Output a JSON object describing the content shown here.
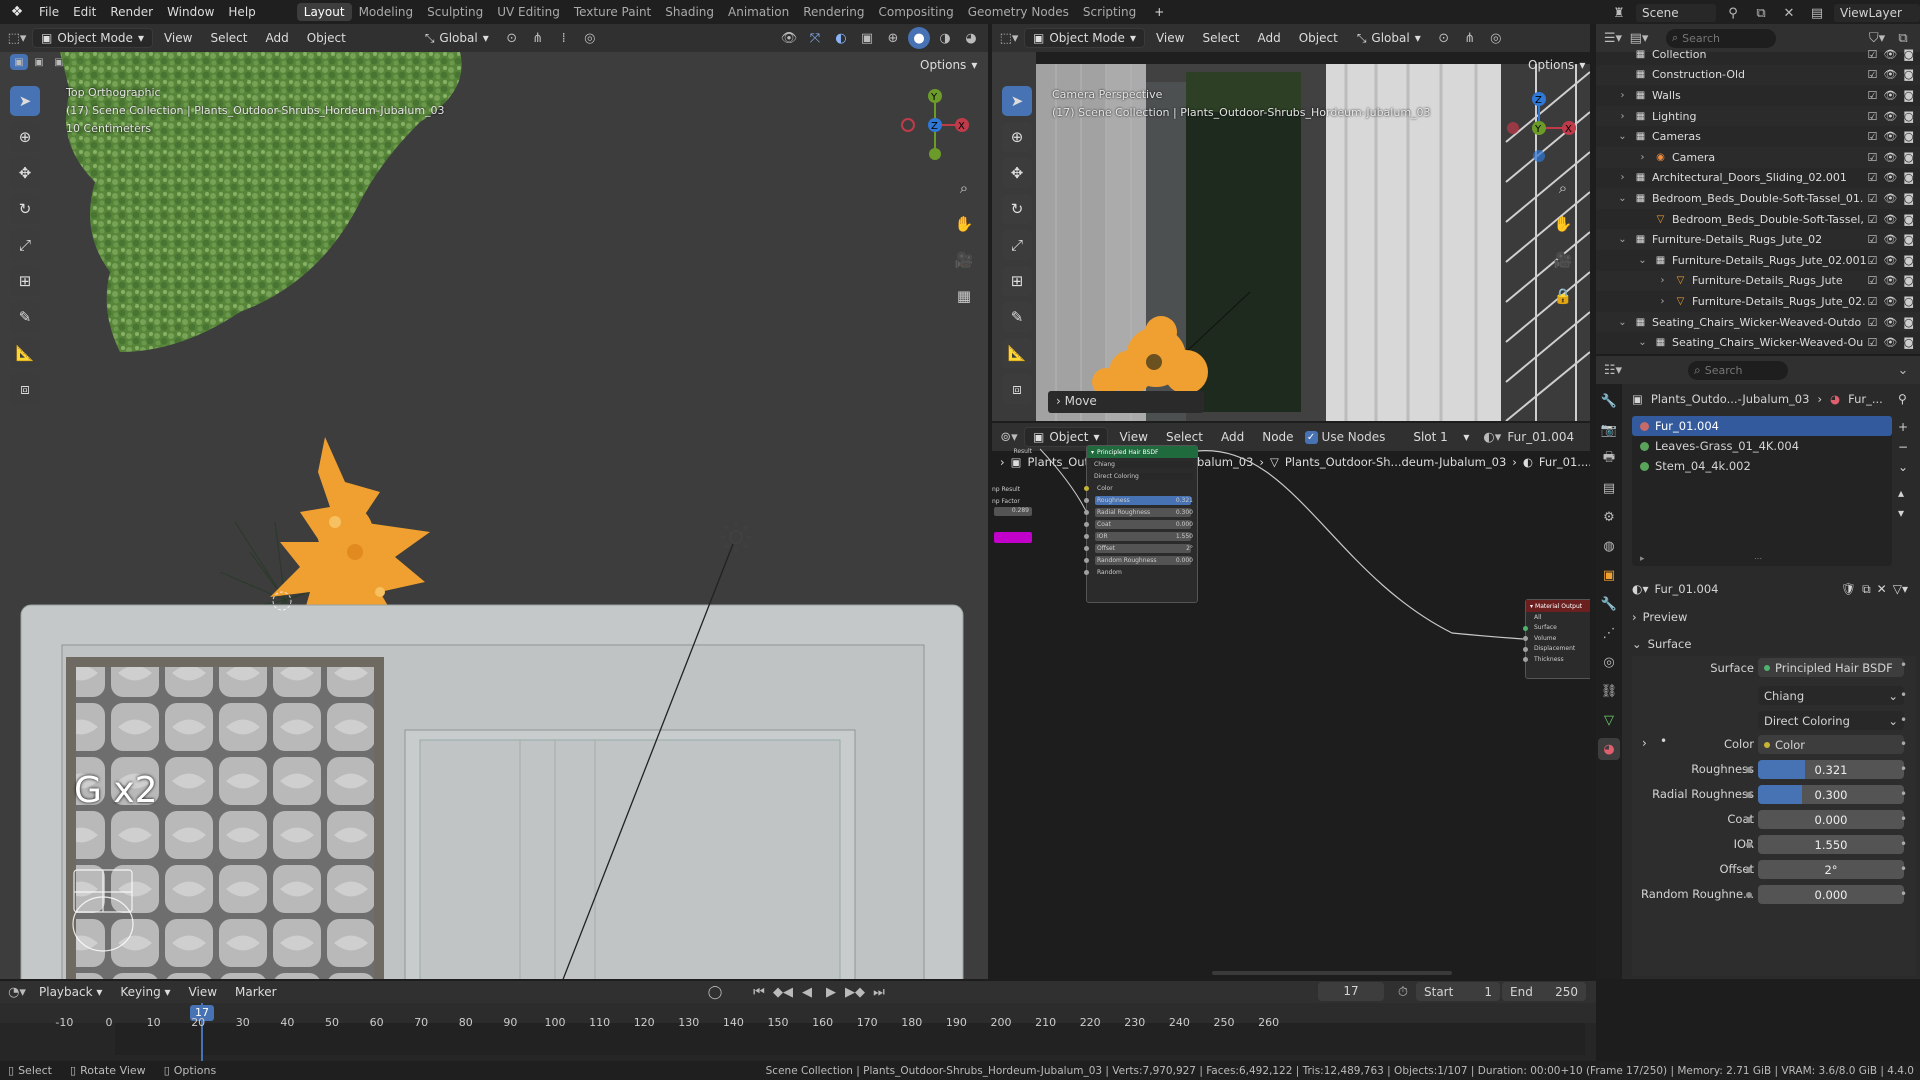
{
  "colors": {
    "accent": "#4772b3",
    "selected_row": "#335a9c",
    "plant": "#f0a030",
    "greenery": "#5f8d3e",
    "node_header_green": "#1f6b3e"
  },
  "topbar": {
    "menus": [
      "File",
      "Edit",
      "Render",
      "Window",
      "Help"
    ],
    "workspaces": [
      "Layout",
      "Modeling",
      "Sculpting",
      "UV Editing",
      "Texture Paint",
      "Shading",
      "Animation",
      "Rendering",
      "Compositing",
      "Geometry Nodes",
      "Scripting"
    ],
    "active_workspace": "Layout",
    "add_tab": "+",
    "scene": "Scene",
    "view_layer": "ViewLayer"
  },
  "viewport_left": {
    "mode": "Object Mode",
    "menus": [
      "View",
      "Select",
      "Add",
      "Object"
    ],
    "orientation": "Global",
    "options": "Options",
    "overlay": [
      "Top Orthographic",
      "(17) Scene Collection | Plants_Outdoor-Shrubs_Hordeum-Jubalum_03",
      "10 Centimeters"
    ],
    "operator_text": "G x2",
    "gizmo": {
      "x": "X",
      "y": "Y",
      "z": "Z"
    }
  },
  "viewport_right": {
    "mode": "Object Mode",
    "menus": [
      "View",
      "Select",
      "Add",
      "Object"
    ],
    "orientation": "Global",
    "options": "Options",
    "overlay": [
      "Camera Perspective",
      "(17) Scene Collection | Plants_Outdoor-Shrubs_Hordeum-Jubalum_03"
    ],
    "last_op": "Move",
    "gizmo": {
      "x": "X",
      "y": "Y",
      "z": "Z"
    }
  },
  "node_editor": {
    "type": "Object",
    "menus": [
      "View",
      "Select",
      "Add",
      "Node"
    ],
    "use_nodes": "Use Nodes",
    "slot": "Slot 1",
    "material": "Fur_01.004",
    "breadcrumb": [
      "Plants_Outdoor-Sh...rdeum-Jubalum_03",
      "Plants_Outdoor-Sh...deum-Jubalum_03",
      "Fur_01...."
    ],
    "bsdf_node": {
      "title": "Principled Hair BSDF",
      "model": "Chiang",
      "parametrization": "Direct Coloring",
      "rows": [
        {
          "label": "Color",
          "value": ""
        },
        {
          "label": "Roughness",
          "value": "0.321"
        },
        {
          "label": "Radial Roughness",
          "value": "0.300"
        },
        {
          "label": "Coat",
          "value": "0.000"
        },
        {
          "label": "IOR",
          "value": "1.550"
        },
        {
          "label": "Offset",
          "value": "2°"
        },
        {
          "label": "Random Roughness",
          "value": "0.000"
        },
        {
          "label": "Random",
          "value": ""
        }
      ]
    },
    "left_node": {
      "title": "Result",
      "rows": [
        "np Result",
        "np Factor"
      ],
      "value": "0.289"
    },
    "output_node": {
      "title": "Material Output",
      "rows": [
        "All",
        "Surface",
        "Volume",
        "Displacement",
        "Thickness"
      ]
    }
  },
  "outliner": {
    "search_placeholder": "Search",
    "rows": [
      {
        "label": "Collection",
        "depth": 0,
        "exp": "",
        "icon": "▦"
      },
      {
        "label": "Construction-Old",
        "depth": 0,
        "exp": "",
        "icon": "▦"
      },
      {
        "label": "Walls",
        "depth": 0,
        "exp": "›",
        "icon": "▦"
      },
      {
        "label": "Lighting",
        "depth": 0,
        "exp": "›",
        "icon": "▦"
      },
      {
        "label": "Cameras",
        "depth": 0,
        "exp": "⌄",
        "icon": "▦"
      },
      {
        "label": "Camera",
        "depth": 1,
        "exp": "›",
        "icon": "◉"
      },
      {
        "label": "Architectural_Doors_Sliding_02.001",
        "depth": 0,
        "exp": "›",
        "icon": "▦"
      },
      {
        "label": "Bedroom_Beds_Double-Soft-Tassel_01.",
        "depth": 0,
        "exp": "⌄",
        "icon": "▦"
      },
      {
        "label": "Bedroom_Beds_Double-Soft-Tassel,",
        "depth": 1,
        "exp": "",
        "icon": "▽"
      },
      {
        "label": "Furniture-Details_Rugs_Jute_02",
        "depth": 0,
        "exp": "⌄",
        "icon": "▦"
      },
      {
        "label": "Furniture-Details_Rugs_Jute_02.001",
        "depth": 1,
        "exp": "⌄",
        "icon": "▦"
      },
      {
        "label": "Furniture-Details_Rugs_Jute",
        "depth": 2,
        "exp": "›",
        "icon": "▽"
      },
      {
        "label": "Furniture-Details_Rugs_Jute_02.",
        "depth": 2,
        "exp": "›",
        "icon": "▽"
      },
      {
        "label": "Seating_Chairs_Wicker-Weaved-Outdo",
        "depth": 0,
        "exp": "⌄",
        "icon": "▦"
      },
      {
        "label": "Seating_Chairs_Wicker-Weaved-Ou",
        "depth": 1,
        "exp": "⌄",
        "icon": "▦"
      }
    ]
  },
  "properties": {
    "search_placeholder": "Search",
    "breadcrumb": [
      "Plants_Outdo...-Jubalum_03",
      "Fur_..."
    ],
    "material_slots": [
      "Fur_01.004",
      "Leaves-Grass_01_4K.004",
      "Stem_04_4k.002"
    ],
    "material_name": "Fur_01.004",
    "panels": {
      "preview": "Preview",
      "surface": "Surface"
    },
    "surface_label": "Surface",
    "surface_value": "Principled Hair BSDF",
    "model": "Chiang",
    "parametrization": "Direct Coloring",
    "color_label": "Color",
    "color_value": "Color",
    "fields": [
      {
        "label": "Roughness",
        "value": "0.321",
        "fill": 0.321
      },
      {
        "label": "Radial Roughness",
        "value": "0.300",
        "fill": 0.3
      },
      {
        "label": "Coat",
        "value": "0.000",
        "fill": 0
      },
      {
        "label": "IOR",
        "value": "1.550",
        "fill": 0
      },
      {
        "label": "Offset",
        "value": "2°",
        "fill": 0
      },
      {
        "label": "Random Roughne...",
        "value": "0.000",
        "fill": 0
      }
    ]
  },
  "timeline": {
    "menus": [
      "Playback",
      "Keying",
      "View",
      "Marker"
    ],
    "current_frame": "17",
    "start_label": "Start",
    "start": "1",
    "end_label": "End",
    "end": "250",
    "ticks": [
      "-10",
      "0",
      "10",
      "20",
      "30",
      "40",
      "50",
      "60",
      "70",
      "80",
      "90",
      "100",
      "110",
      "120",
      "130",
      "140",
      "150",
      "160",
      "170",
      "180",
      "190",
      "200",
      "210",
      "220",
      "230",
      "240",
      "250",
      "260"
    ],
    "playhead": "17"
  },
  "statusbar": {
    "left": [
      "Select",
      "Rotate View",
      "Options"
    ],
    "info": "Scene Collection | Plants_Outdoor-Shrubs_Hordeum-Jubalum_03 | Verts:7,970,927 | Faces:6,492,122 | Tris:12,489,763 | Objects:1/107 | Duration: 00:00+10 (Frame 17/250) | Memory: 2.71 GiB | VRAM: 3.6/8.0 GiB | 4.4.0"
  }
}
